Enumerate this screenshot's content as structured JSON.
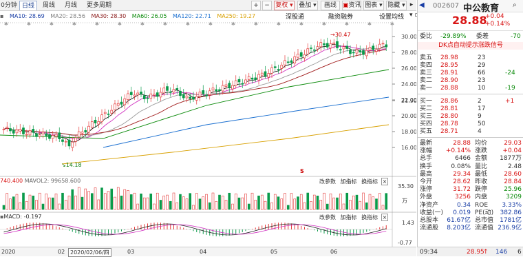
{
  "tabs": [
    "0分钟",
    "日线",
    "周线",
    "月线",
    "更多周期"
  ],
  "toolbar": {
    "plus": "+",
    "minus": "−",
    "fuquan": "复权",
    "diejia": "叠加",
    "huachou": "画线",
    "zixun": "资讯",
    "tubiao": "图表",
    "small": "隐藏"
  },
  "ma": [
    {
      "label": "MA10: 28.69",
      "color": "#1a3fa6"
    },
    {
      "label": "MA20: 28.56",
      "color": "#808080"
    },
    {
      "label": "MA30: 28.30",
      "color": "#8a1a1a"
    },
    {
      "label": "MA60: 26.05",
      "color": "#0a8a0a"
    },
    {
      "label": "MA120: 22.71",
      "color": "#1a6fd0"
    },
    {
      "label": "MA250: 19.27",
      "color": "#d8a000"
    }
  ],
  "toolbar2": [
    "深股通",
    "融资融券",
    "设置均线"
  ],
  "price_axis": [
    "30.00",
    "28.00",
    "26.00",
    "24.00",
    "22.00",
    "21.90",
    "20.00",
    "18.00",
    "16.00"
  ],
  "high_label": "30.47",
  "low_label": "14.18",
  "s_mark": "S",
  "vol": {
    "label_main": "740.400",
    "label_ma": "MAVOL2: 99658.600",
    "axis_top": "35.30",
    "axis_unit": "万",
    "tools": [
      "改参数",
      "加指标",
      "换指标"
    ]
  },
  "macd": {
    "label": "MACD: -0.197",
    "axis_top": "1.43",
    "axis_bottom": "-0.77",
    "tools": [
      "改参数",
      "加指标",
      "换指标"
    ]
  },
  "xaxis": {
    "year": "2020",
    "d1": "02",
    "cursor": "2020/02/06/四",
    "d3": "03",
    "d4": "04",
    "d5": "05",
    "d6": "06"
  },
  "stock": {
    "code": "002607",
    "name": "中公教育",
    "price": "28.88",
    "chg": "+0.04",
    "pct": "+0.14%"
  },
  "weibi": {
    "label": "委比",
    "value": "-29.89%",
    "label2": "委差",
    "value2": "-70"
  },
  "alert": "DK点自动提示涨跌信号",
  "sells": [
    {
      "n": "卖五",
      "p": "28.98",
      "v": "23",
      "d": ""
    },
    {
      "n": "卖四",
      "p": "28.95",
      "v": "29",
      "d": ""
    },
    {
      "n": "卖三",
      "p": "28.91",
      "v": "66",
      "d": "-24"
    },
    {
      "n": "卖二",
      "p": "28.90",
      "v": "23",
      "d": ""
    },
    {
      "n": "卖一",
      "p": "28.88",
      "v": "10",
      "d": "-19"
    }
  ],
  "buys": [
    {
      "n": "买一",
      "p": "28.86",
      "v": "2",
      "d": "+1"
    },
    {
      "n": "买二",
      "p": "28.81",
      "v": "17",
      "d": ""
    },
    {
      "n": "买三",
      "p": "28.80",
      "v": "9",
      "d": ""
    },
    {
      "n": "买四",
      "p": "28.78",
      "v": "50",
      "d": ""
    },
    {
      "n": "买五",
      "p": "28.71",
      "v": "4",
      "d": ""
    }
  ],
  "quote": [
    [
      "最新",
      "28.88",
      "均价",
      "29.03"
    ],
    [
      "涨幅",
      "+0.14%",
      "涨跌",
      "+0.04"
    ],
    [
      "总手",
      "6466",
      "金额",
      "1877万"
    ],
    [
      "换手",
      "0.08%",
      "量比",
      "2.48"
    ],
    [
      "最高",
      "29.34",
      "最低",
      "28.60"
    ],
    [
      "今开",
      "28.62",
      "昨收",
      "28.84"
    ],
    [
      "涨停",
      "31.72",
      "跌停",
      "25.96"
    ],
    [
      "外盘",
      "3256",
      "内盘",
      "3209"
    ],
    [
      "净资产",
      "0.34",
      "ROE",
      "3.33%"
    ],
    [
      "收益(一)",
      "0.019",
      "PE(动)",
      "382.86"
    ],
    [
      "总股本",
      "61.67亿",
      "总市值",
      "1781亿"
    ],
    [
      "流通股",
      "8.203亿",
      "流通值",
      "236.9亿"
    ]
  ],
  "status": {
    "time": "09:34",
    "price": "28.95",
    "vol": "146",
    "x": "6"
  }
}
